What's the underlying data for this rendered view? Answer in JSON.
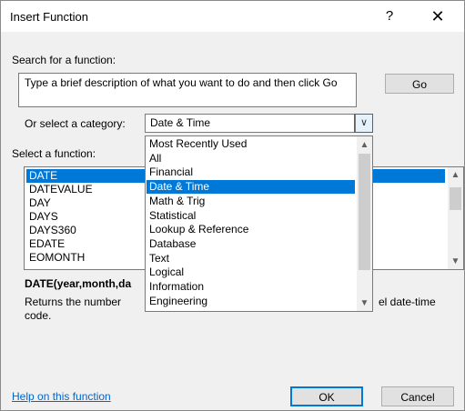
{
  "window": {
    "title": "Insert Function",
    "help_glyph": "?",
    "close_glyph": "✕"
  },
  "search": {
    "label": "Search for a function:",
    "text": "Type a brief description of what you want to do and then click Go",
    "go_label": "Go"
  },
  "category": {
    "label": "Or select a category:",
    "value": "Date & Time",
    "options": [
      "Most Recently Used",
      "All",
      "Financial",
      "Date & Time",
      "Math & Trig",
      "Statistical",
      "Lookup & Reference",
      "Database",
      "Text",
      "Logical",
      "Information",
      "Engineering"
    ],
    "selected": "Date & Time"
  },
  "functions": {
    "label": "Select a function:",
    "items": [
      "DATE",
      "DATEVALUE",
      "DAY",
      "DAYS",
      "DAYS360",
      "EDATE",
      "EOMONTH"
    ],
    "selected": "DATE"
  },
  "details": {
    "signature": "DATE(year,month,da",
    "description_left": "Returns the number",
    "description_right": "el date-time",
    "description_line2": "code."
  },
  "footer": {
    "help_link": "Help on this function",
    "ok_label": "OK",
    "cancel_label": "Cancel"
  }
}
